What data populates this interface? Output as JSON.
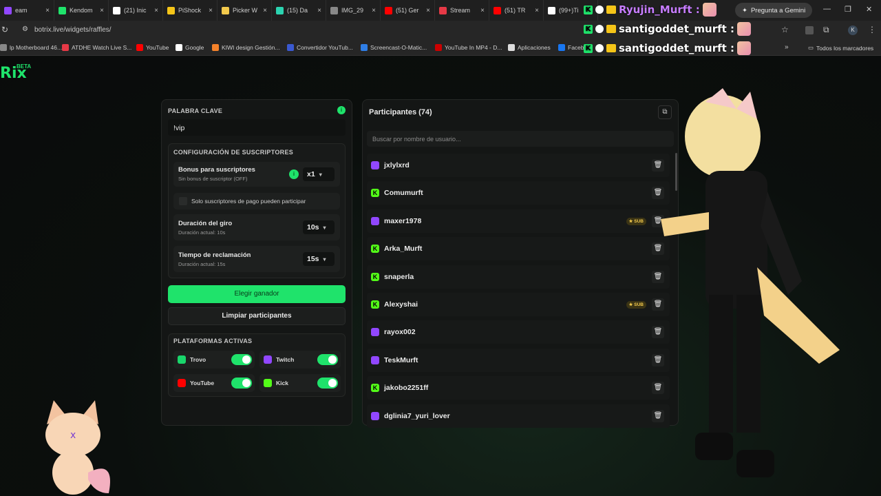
{
  "browser": {
    "tabs": [
      {
        "label": "eam",
        "color": "#9147ff"
      },
      {
        "label": "Kendom",
        "color": "#1fe36b"
      },
      {
        "label": "(21) Inic",
        "color": "#ffffff"
      },
      {
        "label": "PiShock",
        "color": "#f5c518"
      },
      {
        "label": "Picker W",
        "color": "#f2c94c"
      },
      {
        "label": "(15) Da",
        "color": "#2bd3b0"
      },
      {
        "label": "IMG_29",
        "color": "#888888"
      },
      {
        "label": "(51) Ger",
        "color": "#ff0000"
      },
      {
        "label": "Stream",
        "color": "#e63946"
      },
      {
        "label": "(51) TR",
        "color": "#ff0000"
      },
      {
        "label": "(99+)Ti",
        "color": "#ffffff"
      }
    ],
    "tab_close_glyph": "×",
    "gemini_button": "Pregunta a Gemini",
    "url": "botrix.live/widgets/raffles/",
    "bookmarks": [
      {
        "label": "lp Motherboard 46...",
        "color": "#888888"
      },
      {
        "label": "ATDHE Watch Live S...",
        "color": "#e63946"
      },
      {
        "label": "YouTube",
        "color": "#ff0000"
      },
      {
        "label": "Google",
        "color": "#ffffff"
      },
      {
        "label": "KIWI design Gestión...",
        "color": "#f5822a"
      },
      {
        "label": "Convertidor YouTub...",
        "color": "#3a59d1"
      },
      {
        "label": "Screencast-O-Matic...",
        "color": "#2f7ee6"
      },
      {
        "label": "YouTube In MP4 - D...",
        "color": "#cc0000"
      },
      {
        "label": "Aplicaciones",
        "color": "#dddddd"
      },
      {
        "label": "Faceb",
        "color": "#1877f2"
      }
    ],
    "all_bookmarks": "Todos los marcadores"
  },
  "chat": [
    {
      "user": "Ryujin_Murft :",
      "color": "#c77dff"
    },
    {
      "user": "santigoddet_murft :",
      "color": "#ffffff"
    },
    {
      "user": "santigoddet_murft :",
      "color": "#ffffff"
    }
  ],
  "logo": {
    "text": "Rix",
    "badge": "BETA"
  },
  "left": {
    "keyword_label": "PALABRA CLAVE",
    "keyword_value": "!vip",
    "sub_config_label": "CONFIGURACIÓN DE SUSCRIPTORES",
    "bonus_title": "Bonus para suscriptores",
    "bonus_sub": "Sin bonus de suscriptor (OFF)",
    "bonus_value": "x1",
    "paid_only": "Solo suscriptores de pago pueden participar",
    "spin_title": "Duración del giro",
    "spin_sub": "Duración actual: 10s",
    "spin_value": "10s",
    "claim_title": "Tiempo de reclamación",
    "claim_sub": "Duración actual: 15s",
    "claim_value": "15s",
    "pick_winner": "Elegir ganador",
    "clear": "Limpiar participantes",
    "platforms_label": "PLATAFORMAS ACTIVAS",
    "platforms": [
      {
        "name": "Trovo",
        "color": "#19d66b",
        "on": true
      },
      {
        "name": "Twitch",
        "color": "#9147ff",
        "on": true
      },
      {
        "name": "YouTube",
        "color": "#ff0000",
        "on": true
      },
      {
        "name": "Kick",
        "color": "#53fc18",
        "on": true
      }
    ]
  },
  "right": {
    "title": "Participantes (74)",
    "search_placeholder": "Buscar por nombre de usuario...",
    "participants": [
      {
        "name": "jxlylxrd",
        "platform": "twitch",
        "sub": false
      },
      {
        "name": "Comumurft",
        "platform": "kick",
        "sub": false
      },
      {
        "name": "maxer1978",
        "platform": "twitch",
        "sub": true
      },
      {
        "name": "Arka_Murft",
        "platform": "kick",
        "sub": false
      },
      {
        "name": "snaperla",
        "platform": "kick",
        "sub": false
      },
      {
        "name": "Alexyshai",
        "platform": "kick",
        "sub": true
      },
      {
        "name": "rayox002",
        "platform": "twitch",
        "sub": false
      },
      {
        "name": "TeskMurft",
        "platform": "twitch",
        "sub": false
      },
      {
        "name": "jakobo2251ff",
        "platform": "kick",
        "sub": false
      },
      {
        "name": "dglinia7_yuri_lover",
        "platform": "twitch",
        "sub": false
      }
    ],
    "sub_badge": "SUB"
  },
  "colors": {
    "accent": "#1fe36b",
    "twitch": "#9147ff",
    "kick": "#53fc18"
  }
}
